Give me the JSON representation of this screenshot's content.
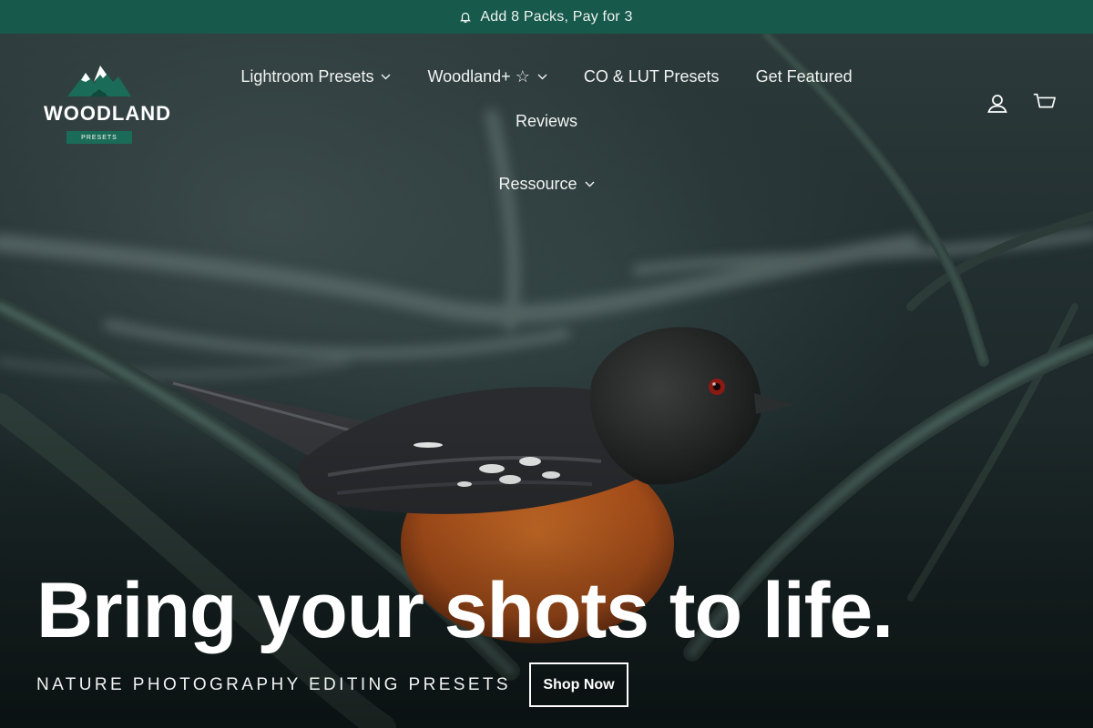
{
  "announcement": {
    "icon": "bell-icon",
    "text": "Add 8 Packs, Pay for 3"
  },
  "logo": {
    "brand": "WOODLAND",
    "tagline": "PRESETS"
  },
  "nav": {
    "items": [
      {
        "label": "Lightroom Presets",
        "has_dropdown": true
      },
      {
        "label": "Woodland+ ☆",
        "has_dropdown": true
      },
      {
        "label": "CO & LUT Presets",
        "has_dropdown": false
      },
      {
        "label": "Get Featured",
        "has_dropdown": false
      },
      {
        "label": "Reviews",
        "has_dropdown": false
      },
      {
        "label": "Ressource",
        "has_dropdown": true
      }
    ]
  },
  "header_icons": {
    "account": "account-icon",
    "cart": "cart-icon"
  },
  "hero": {
    "headline": "Bring your shots to life.",
    "subtitle": "NATURE PHOTOGRAPHY EDITING PRESETS",
    "cta_label": "Shop Now"
  },
  "colors": {
    "announcement_bg": "#17594b",
    "logo_green": "#1a6b57",
    "text": "#ffffff"
  }
}
